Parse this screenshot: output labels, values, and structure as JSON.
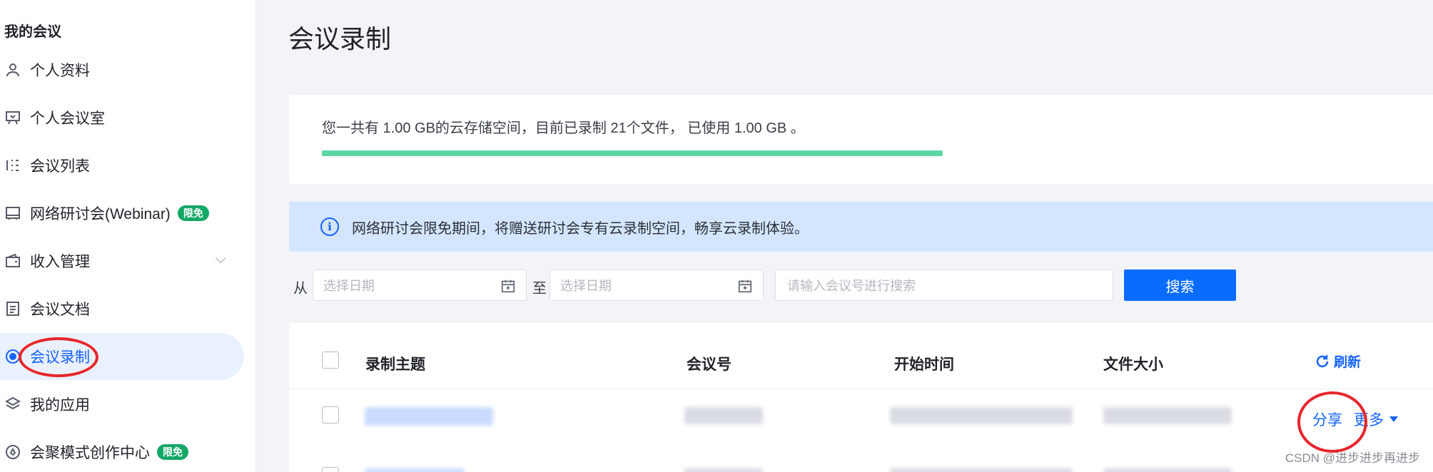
{
  "sidebar": {
    "section_title": "我的会议",
    "items": [
      {
        "label": "个人资料",
        "icon": "user-icon"
      },
      {
        "label": "个人会议室",
        "icon": "presentation-icon"
      },
      {
        "label": "会议列表",
        "icon": "list-icon"
      },
      {
        "label": "网络研讨会(Webinar)",
        "icon": "webinar-icon",
        "badge": "限免"
      },
      {
        "label": "收入管理",
        "icon": "wallet-icon"
      },
      {
        "label": "会议文档",
        "icon": "document-icon"
      },
      {
        "label": "会议录制",
        "icon": "record-icon"
      },
      {
        "label": "我的应用",
        "icon": "layers-icon"
      },
      {
        "label": "会聚模式创作中心",
        "icon": "creator-icon",
        "badge": "限免"
      }
    ],
    "active_item": "会议录制"
  },
  "main": {
    "title": "会议录制",
    "storage": {
      "text": "您一共有 1.00 GB的云存储空间，目前已录制 21个文件， 已使用 1.00 GB 。",
      "usage_fraction": 1.0
    },
    "info_banner": "网络研讨会限免期间，将赠送研讨会专有云录制空间，畅享云录制体验。",
    "filters": {
      "from_label": "从",
      "to_label": "至",
      "start_date_placeholder": "选择日期",
      "end_date_placeholder": "选择日期",
      "search_placeholder": "请输入会议号进行搜索",
      "search_button": "搜索"
    },
    "table": {
      "columns": [
        "录制主题",
        "会议号",
        "开始时间",
        "文件大小"
      ],
      "refresh_label": "刷新",
      "row_actions": {
        "share": "分享",
        "more": "更多"
      }
    }
  },
  "watermark": "CSDN @进步进步再进步",
  "colors": {
    "accent": "#1664ff",
    "progress": "#5fd6a6",
    "badge": "#13a866",
    "annotation": "#e8262b",
    "info_bg": "#d4e6ff"
  }
}
